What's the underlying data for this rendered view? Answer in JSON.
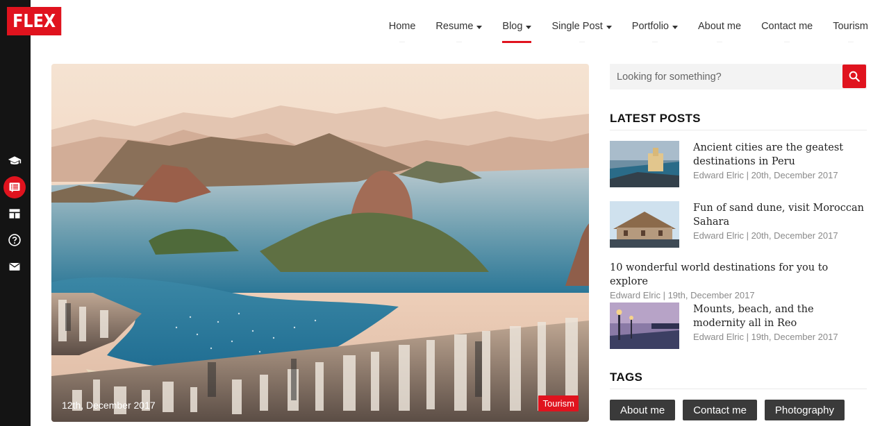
{
  "brand": {
    "logo_text": "FLEX",
    "accent": "#e0131e"
  },
  "nav": {
    "items": [
      {
        "label": "Home",
        "dropdown": false,
        "active": false
      },
      {
        "label": "Resume",
        "dropdown": true,
        "active": false
      },
      {
        "label": "Blog",
        "dropdown": true,
        "active": true
      },
      {
        "label": "Single Post",
        "dropdown": true,
        "active": false
      },
      {
        "label": "Portfolio",
        "dropdown": true,
        "active": false
      },
      {
        "label": "About me",
        "dropdown": false,
        "active": false
      },
      {
        "label": "Contact me",
        "dropdown": false,
        "active": false
      },
      {
        "label": "Tourism",
        "dropdown": false,
        "active": false
      }
    ]
  },
  "side_menu": {
    "icons": [
      "graduation-cap-icon",
      "blog-list-icon",
      "dashboard-icon",
      "help-icon",
      "mail-icon"
    ],
    "active_index": 1
  },
  "featured": {
    "date": "12th, December 2017",
    "category": "Tourism"
  },
  "search": {
    "placeholder": "Looking for something?"
  },
  "latest_posts": {
    "title": "LATEST POSTS",
    "posts": [
      {
        "title": "Ancient cities are the geatest destinations in Peru",
        "meta": "Edward Elric | 20th, December 2017",
        "has_thumb": true
      },
      {
        "title": "Fun of sand dune, visit Moroccan Sahara",
        "meta": "Edward Elric | 20th, December 2017",
        "has_thumb": true
      },
      {
        "title": "10 wonderful world destinations for you to explore",
        "meta": "Edward Elric | 19th, December 2017",
        "has_thumb": false
      },
      {
        "title": "Mounts, beach, and the modernity all in Reo",
        "meta": "Edward Elric | 19th, December 2017",
        "has_thumb": true
      }
    ]
  },
  "tags": {
    "title": "TAGS",
    "items": [
      "About me",
      "Contact me",
      "Photography"
    ]
  }
}
